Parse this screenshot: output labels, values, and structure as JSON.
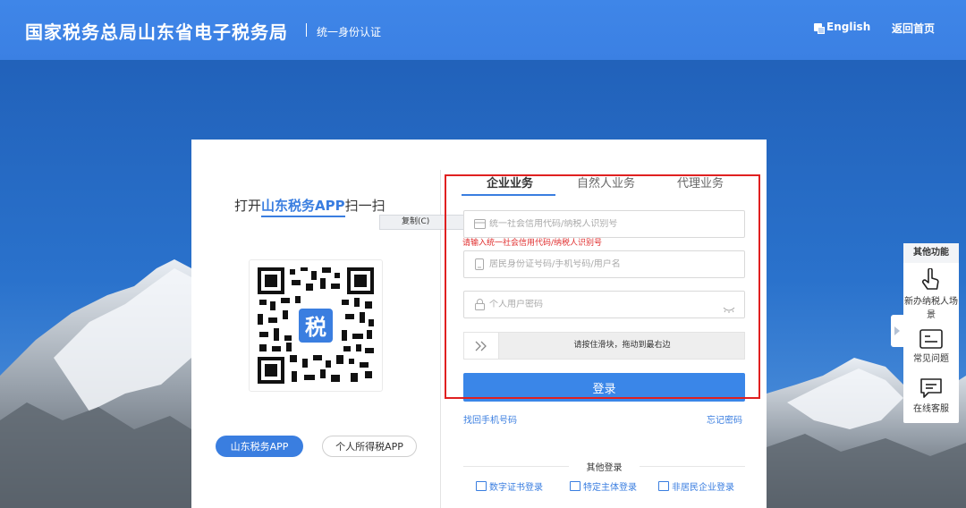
{
  "header": {
    "title": "国家税务总局山东省电子税务局",
    "subtitle": "统一身份认证",
    "lang_label": "English",
    "home_label": "返回首页"
  },
  "left": {
    "scan_prefix": "打开",
    "scan_app": "山东税务APP",
    "scan_suffix": "扫一扫",
    "copy_tip": "复制(C)",
    "qr_center_char": "税",
    "app_buttons": [
      "山东税务APP",
      "个人所得税APP"
    ]
  },
  "tabs": [
    "企业业务",
    "自然人业务",
    "代理业务"
  ],
  "form": {
    "credit_code_placeholder": "统一社会信用代码/纳税人识别号",
    "credit_code_error": "请输入统一社会信用代码/纳税人识别号",
    "id_placeholder": "居民身份证号码/手机号码/用户名",
    "password_placeholder": "个人用户密码",
    "slider_text": "请按住滑块，拖动到最右边",
    "login_label": "登录",
    "find_phone": "找回手机号码",
    "forgot_password": "忘记密码"
  },
  "other_login": {
    "title": "其他登录",
    "items": [
      "数字证书登录",
      "特定主体登录",
      "非居民企业登录"
    ]
  },
  "side_panel": {
    "title": "其他功能",
    "items": [
      "新办纳税人场景",
      "常见问题",
      "在线客服"
    ]
  },
  "colors": {
    "primary": "#3a7ee0",
    "header": "#3f86e8",
    "error": "#e02e2e",
    "highlight": "#e02020"
  }
}
